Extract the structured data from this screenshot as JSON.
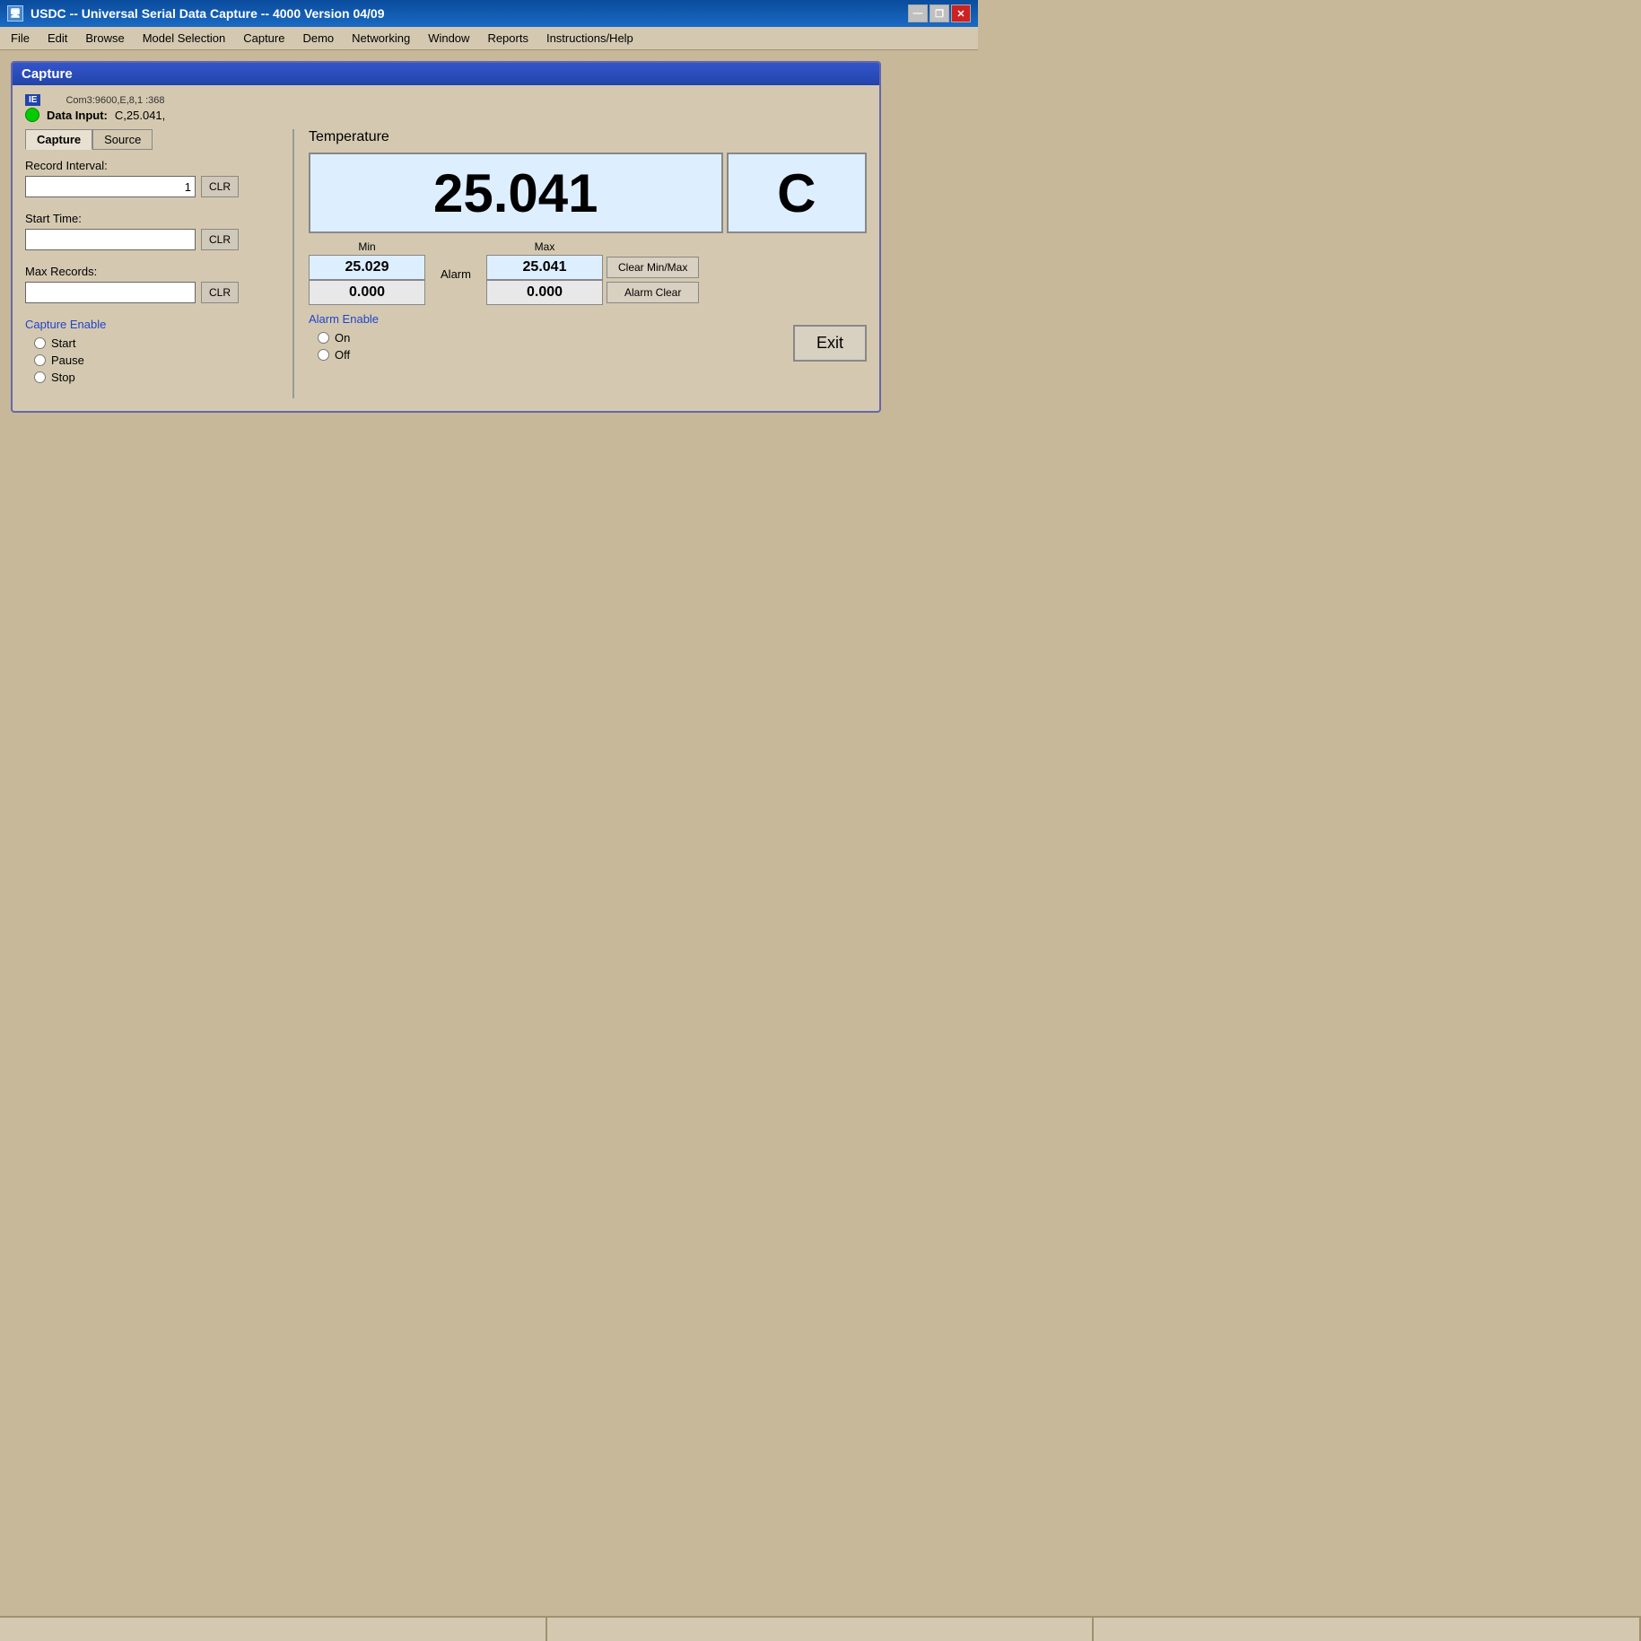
{
  "titleBar": {
    "title": "USDC  --  Universal Serial Data Capture  --  4000    Version 04/09",
    "iconText": "IE",
    "minimizeLabel": "—",
    "restoreLabel": "❐",
    "closeLabel": "✕"
  },
  "menuBar": {
    "items": [
      "File",
      "Edit",
      "Browse",
      "Model Selection",
      "Capture",
      "Demo",
      "Networking",
      "Window",
      "Reports",
      "Instructions/Help"
    ]
  },
  "captureWindow": {
    "title": "Capture",
    "comInfo": "Com3:9600,E,8,1 :368",
    "dataInputLabel": "Data Input:",
    "dataInputValue": "C,25.041,",
    "statusIndicatorColor": "#00cc00"
  },
  "leftPanel": {
    "tabs": [
      "Capture",
      "Source"
    ],
    "activeTab": "Capture",
    "recordIntervalLabel": "Record Interval:",
    "recordIntervalValue": "1",
    "clrLabel1": "CLR",
    "startTimeLabel": "Start Time:",
    "startTimeValue": "",
    "clrLabel2": "CLR",
    "maxRecordsLabel": "Max Records:",
    "maxRecordsValue": "",
    "clrLabel3": "CLR",
    "captureEnableLabel": "Capture Enable",
    "captureOptions": [
      "Start",
      "Pause",
      "Stop"
    ]
  },
  "rightPanel": {
    "temperatureLabel": "Temperature",
    "mainValue": "25.041",
    "unit": "C",
    "minLabel": "Min",
    "maxLabel": "Max",
    "minValue": "25.029",
    "maxValue": "25.041",
    "alarmLabel": "Alarm",
    "alarmMinValue": "0.000",
    "alarmMaxValue": "0.000",
    "clearMinMaxLabel": "Clear Min/Max",
    "alarmClearLabel": "Alarm Clear",
    "alarmEnableLabel": "Alarm Enable",
    "alarmOnLabel": "On",
    "alarmOffLabel": "Off",
    "exitLabel": "Exit"
  }
}
